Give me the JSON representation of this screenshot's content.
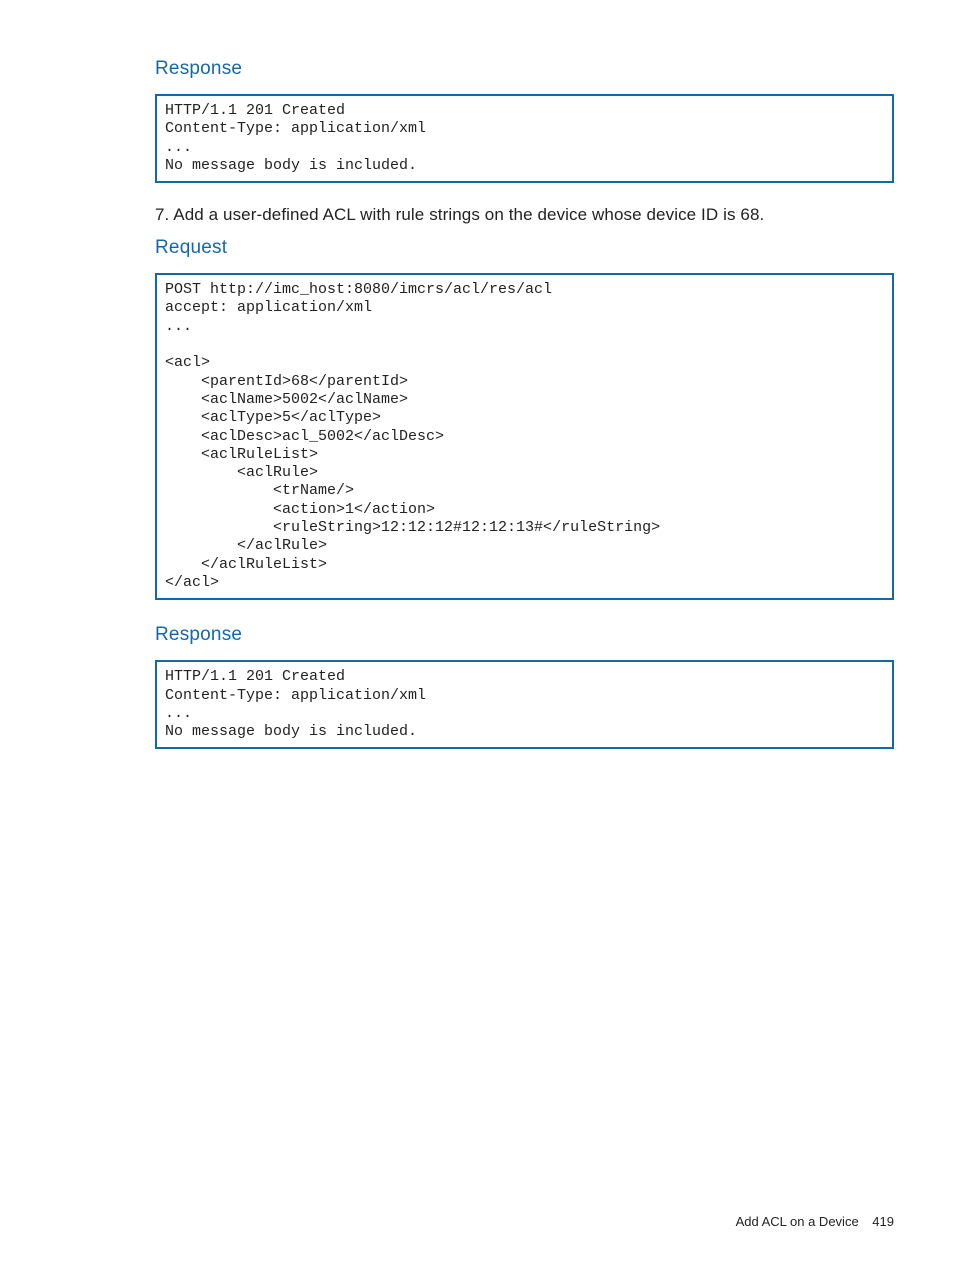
{
  "headings": {
    "response1": "Response",
    "request": "Request",
    "response2": "Response"
  },
  "paragraphs": {
    "step7": "7. Add a user-defined ACL with rule strings on the device whose device ID is 68."
  },
  "codeblocks": {
    "response1": "HTTP/1.1 201 Created\nContent-Type: application/xml\n...\nNo message body is included.",
    "request": "POST http://imc_host:8080/imcrs/acl/res/acl\naccept: application/xml\n...\n\n<acl>\n    <parentId>68</parentId>\n    <aclName>5002</aclName>\n    <aclType>5</aclType>\n    <aclDesc>acl_5002</aclDesc>\n    <aclRuleList>\n        <aclRule>\n            <trName/>\n            <action>1</action>\n            <ruleString>12:12:12#12:12:13#</ruleString>\n        </aclRule>\n    </aclRuleList>\n</acl>",
    "response2": "HTTP/1.1 201 Created\nContent-Type: application/xml\n...\nNo message body is included."
  },
  "footer": {
    "title": "Add ACL on a Device",
    "page": "419"
  }
}
